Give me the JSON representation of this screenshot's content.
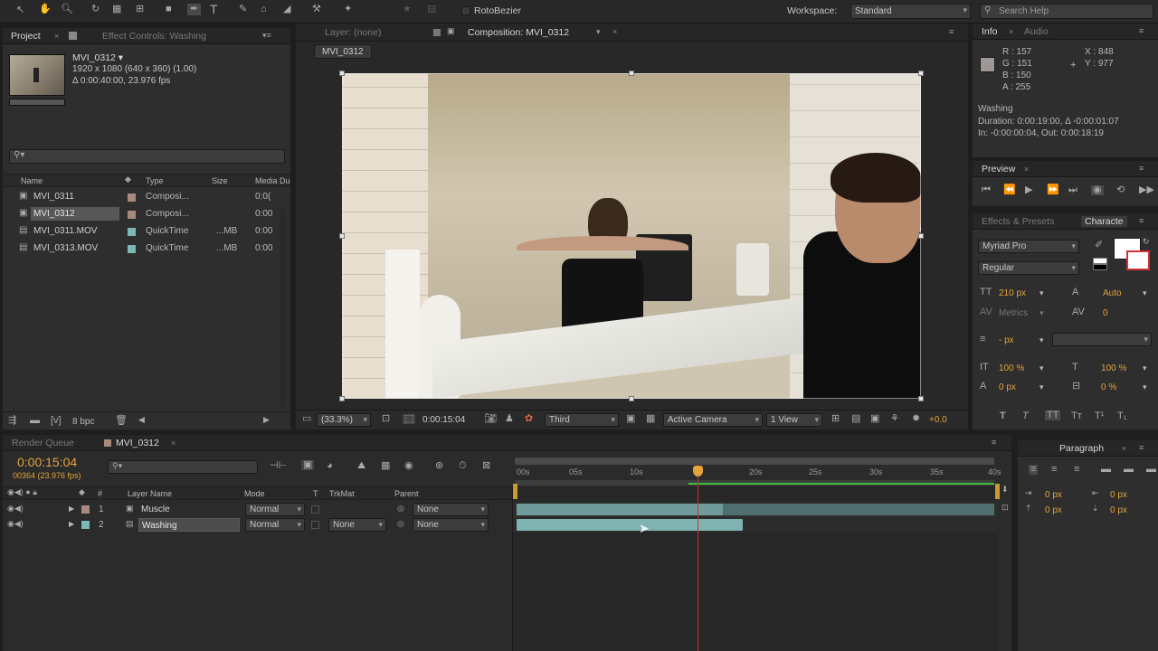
{
  "toolbar": {
    "rotobezier_label": "RotoBezier",
    "workspace_label": "Workspace:",
    "workspace_value": "Standard",
    "search_placeholder": "Search Help"
  },
  "project_panel": {
    "tab_project": "Project",
    "tab_effect_controls": "Effect Controls: Washing",
    "item_name": "MVI_0312 ▾",
    "item_info_1": "1920 x 1080  (640 x 360) (1.00)",
    "item_info_2": "Δ 0:00:40:00, 23.976 fps",
    "search_value": "",
    "columns": {
      "name": "Name",
      "type": "Type",
      "size": "Size",
      "media": "Media Du"
    },
    "items": [
      {
        "name": "MVI_0311",
        "type": "Composi...",
        "size": "",
        "duration": "0:0("
      },
      {
        "name": "MVI_0312",
        "type": "Composi...",
        "size": "",
        "duration": "0:00"
      },
      {
        "name": "MVI_0311.MOV",
        "type": "QuickTime",
        "size": "...MB",
        "duration": "0:00"
      },
      {
        "name": "MVI_0313.MOV",
        "type": "QuickTime",
        "size": "...MB",
        "duration": "0:00"
      }
    ],
    "bpc_label": "8 bpc"
  },
  "viewer": {
    "tab_layer": "Layer: (none)",
    "tab_composition": "Composition: MVI_0312",
    "comp_button": "MVI_0312",
    "zoom": "(33.3%)",
    "timecode": "0:00:15:04",
    "resolution": "Third",
    "camera": "Active Camera",
    "views": "1 View",
    "exposure": "+0.0"
  },
  "info_panel": {
    "tab_info": "Info",
    "tab_audio": "Audio",
    "r": "R : 157",
    "g": "G : 151",
    "b": "B : 150",
    "a": "A : 255",
    "x": "X : 848",
    "y": "Y : 977",
    "layer_name": "Washing",
    "duration": "Duration: 0:00:19:00, Δ -0:00:01:07",
    "in_out": "In: -0:00:00:04, Out: 0:00:18:19"
  },
  "preview_panel": {
    "tab": "Preview"
  },
  "character_panel": {
    "tab_effects": "Effects & Presets",
    "tab_character": "Characte",
    "font": "Myriad Pro",
    "style": "Regular",
    "font_size": "210 px",
    "leading": "Auto",
    "kerning": "Metrics",
    "tracking": "0",
    "stroke": "- px",
    "vscale": "100 %",
    "hscale": "100 %",
    "baseline": "0 px",
    "tsume": "0 %"
  },
  "timeline": {
    "tab_render": "Render Queue",
    "tab_comp": "MVI_0312",
    "timecode": "0:00:15:04",
    "frames": "00364 (23.976 fps)",
    "columns": {
      "layer_name": "Layer Name",
      "mode": "Mode",
      "t": "T",
      "trkmat": "TrkMat",
      "parent": "Parent"
    },
    "ruler": [
      "00s",
      "05s",
      "10s",
      "",
      "20s",
      "25s",
      "30s",
      "35s",
      "40s"
    ],
    "layers": [
      {
        "index": "1",
        "name": "Muscle",
        "mode": "Normal",
        "trkmat": "",
        "parent": "None"
      },
      {
        "index": "2",
        "name": "Washing",
        "mode": "Normal",
        "trkmat": "None",
        "parent": "None"
      }
    ]
  },
  "paragraph_panel": {
    "tab": "Paragraph",
    "indent_left": "0 px",
    "indent_right": "0 px",
    "space_before": "0 px",
    "space_after": "0 px"
  },
  "colors": {
    "accent": "#e2a43a",
    "layer_bar": "#7eb3b1",
    "playhead": "#d92a2a"
  }
}
